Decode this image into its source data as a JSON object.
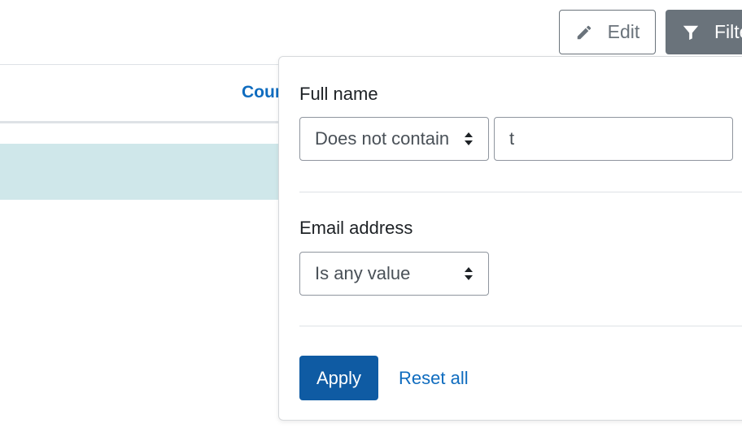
{
  "toolbar": {
    "edit_label": "Edit",
    "filters_label": "Filte",
    "edit_icon": "pencil-icon",
    "filters_icon": "funnel-icon"
  },
  "table": {
    "column_header": "Cour"
  },
  "filter_panel": {
    "full_name": {
      "label": "Full name",
      "operator": "Does not contain",
      "value": "t"
    },
    "email": {
      "label": "Email address",
      "operator": "Is any value"
    },
    "apply_label": "Apply",
    "reset_label": "Reset all"
  },
  "colors": {
    "primary": "#0f6cbf",
    "apply_button": "#0f5ba3",
    "secondary_button": "#6a737b",
    "row_highlight": "#cfe7ea"
  }
}
